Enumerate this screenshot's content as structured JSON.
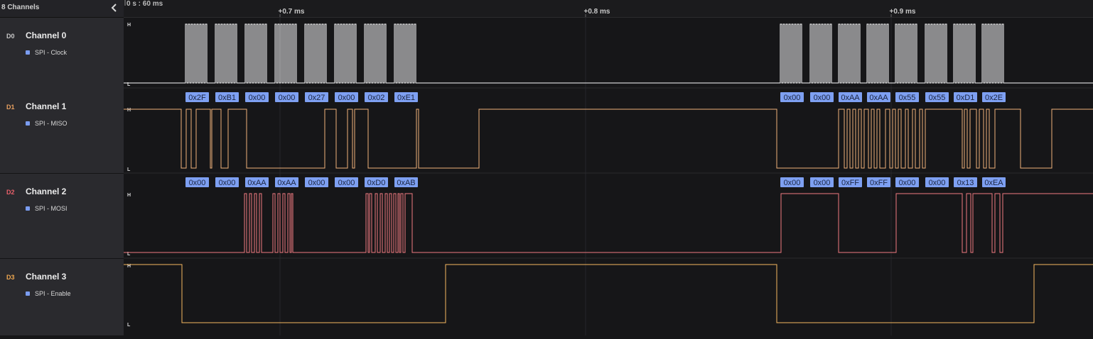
{
  "sidebar": {
    "title": "8 Channels",
    "channels": [
      {
        "id": "D0",
        "name": "Channel 0",
        "analyzer": "SPI - Clock",
        "color": "#ffffff",
        "id_color": "#c8c8c8"
      },
      {
        "id": "D1",
        "name": "Channel 1",
        "analyzer": "SPI - MISO",
        "color": "#f0b27a",
        "id_color": "#e8a060"
      },
      {
        "id": "D2",
        "name": "Channel 2",
        "analyzer": "SPI - MOSI",
        "color": "#f07a80",
        "id_color": "#e8606a"
      },
      {
        "id": "D3",
        "name": "Channel 3",
        "analyzer": "SPI - Enable",
        "color": "#f5b860",
        "id_color": "#f0a850"
      }
    ]
  },
  "timeline": {
    "origin_label": "0 s : 60 ms",
    "markers": [
      {
        "label": "+0.7 ms",
        "t": 0.7
      },
      {
        "label": "+0.8 ms",
        "t": 0.8
      },
      {
        "label": "+0.9 ms",
        "t": 0.9
      }
    ]
  },
  "level_labels": {
    "high": "H",
    "low": "L"
  },
  "decoded": {
    "miso": {
      "burst1": [
        "0x2F",
        "0xB1",
        "0x00",
        "0x00",
        "0x27",
        "0x00",
        "0x02",
        "0xE1"
      ],
      "burst2": [
        "0x00",
        "0x00",
        "0xAA",
        "0xAA",
        "0x55",
        "0x55",
        "0xD1",
        "0x2E"
      ]
    },
    "mosi": {
      "burst1": [
        "0x00",
        "0x00",
        "0xAA",
        "0xAA",
        "0x00",
        "0x00",
        "0xD0",
        "0xAB"
      ],
      "burst2": [
        "0x00",
        "0x00",
        "0xFF",
        "0xFF",
        "0x00",
        "0x00",
        "0x13",
        "0xEA"
      ]
    }
  },
  "colors": {
    "bubble_bg": "#7ea0f2",
    "bubble_text": "#1a2440",
    "accent": "#7a9cf0"
  }
}
